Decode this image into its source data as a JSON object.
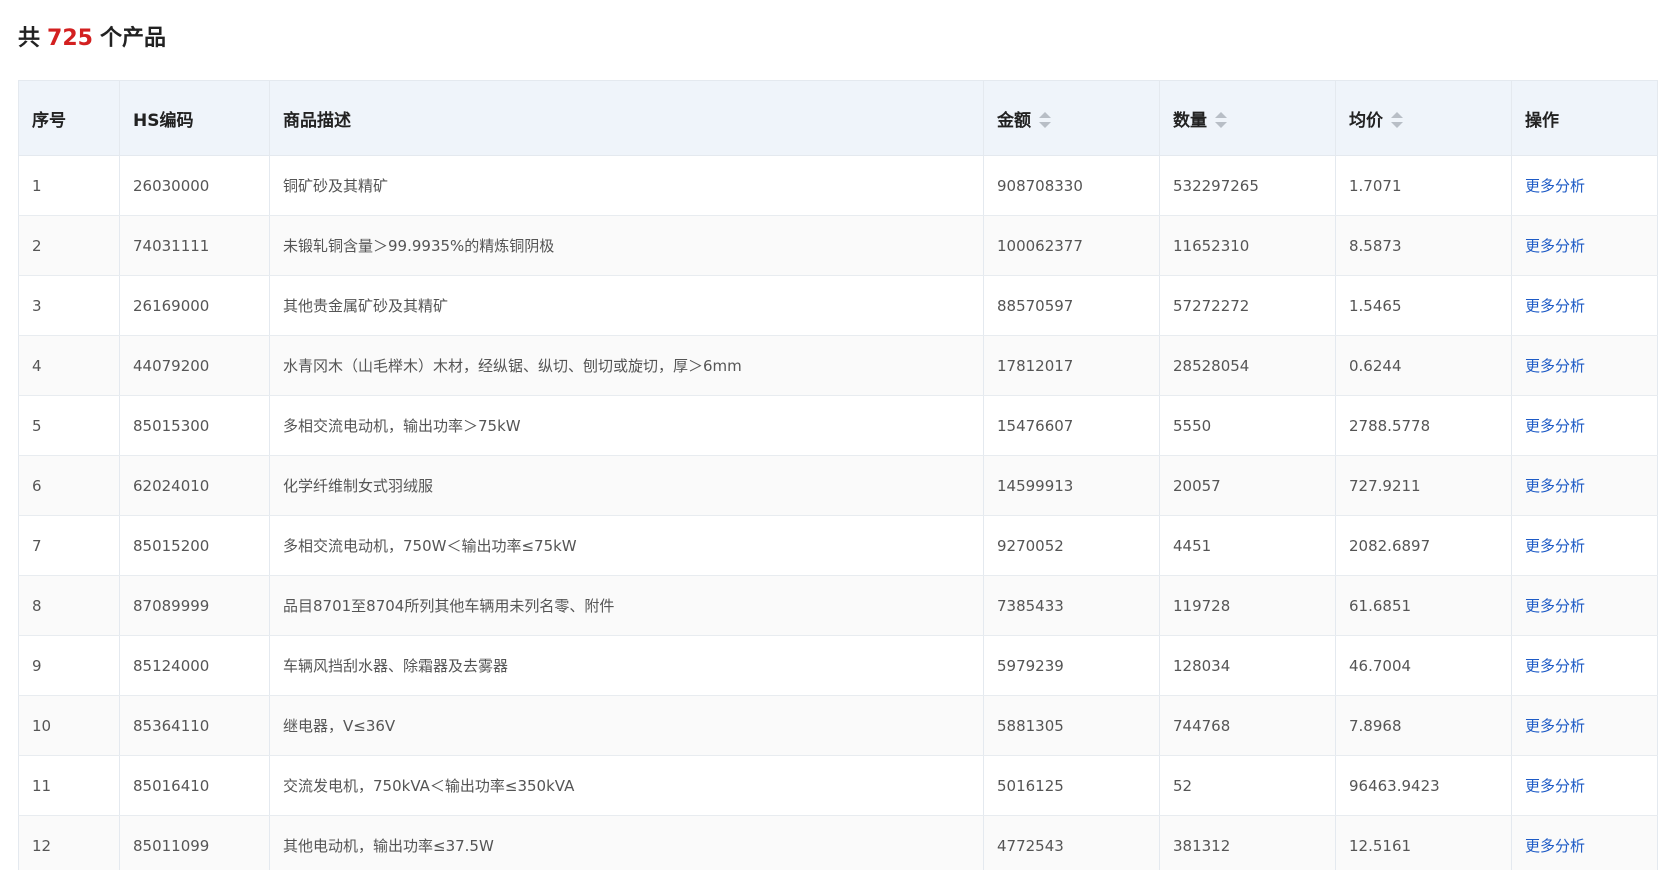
{
  "summary": {
    "prefix": "共",
    "count": "725",
    "suffix": "个产品"
  },
  "table": {
    "headers": {
      "index": "序号",
      "hs_code": "HS编码",
      "description": "商品描述",
      "amount": "金额",
      "quantity": "数量",
      "avg_price": "均价",
      "actions": "操作"
    },
    "sortable_columns": [
      "amount",
      "quantity",
      "avg_price"
    ],
    "action_label": "更多分析",
    "rows": [
      {
        "index": "1",
        "hs_code": "26030000",
        "description": "铜矿砂及其精矿",
        "amount": "908708330",
        "quantity": "532297265",
        "avg_price": "1.7071"
      },
      {
        "index": "2",
        "hs_code": "74031111",
        "description": "未锻轧铜含量＞99.9935%的精炼铜阴极",
        "amount": "100062377",
        "quantity": "11652310",
        "avg_price": "8.5873"
      },
      {
        "index": "3",
        "hs_code": "26169000",
        "description": "其他贵金属矿砂及其精矿",
        "amount": "88570597",
        "quantity": "57272272",
        "avg_price": "1.5465"
      },
      {
        "index": "4",
        "hs_code": "44079200",
        "description": "水青冈木（山毛榉木）木材，经纵锯、纵切、刨切或旋切，厚＞6mm",
        "amount": "17812017",
        "quantity": "28528054",
        "avg_price": "0.6244"
      },
      {
        "index": "5",
        "hs_code": "85015300",
        "description": "多相交流电动机，输出功率＞75kW",
        "amount": "15476607",
        "quantity": "5550",
        "avg_price": "2788.5778"
      },
      {
        "index": "6",
        "hs_code": "62024010",
        "description": "化学纤维制女式羽绒服",
        "amount": "14599913",
        "quantity": "20057",
        "avg_price": "727.9211"
      },
      {
        "index": "7",
        "hs_code": "85015200",
        "description": "多相交流电动机，750W＜输出功率≤75kW",
        "amount": "9270052",
        "quantity": "4451",
        "avg_price": "2082.6897"
      },
      {
        "index": "8",
        "hs_code": "87089999",
        "description": "品目8701至8704所列其他车辆用未列名零、附件",
        "amount": "7385433",
        "quantity": "119728",
        "avg_price": "61.6851"
      },
      {
        "index": "9",
        "hs_code": "85124000",
        "description": "车辆风挡刮水器、除霜器及去雾器",
        "amount": "5979239",
        "quantity": "128034",
        "avg_price": "46.7004"
      },
      {
        "index": "10",
        "hs_code": "85364110",
        "description": "继电器，V≤36V",
        "amount": "5881305",
        "quantity": "744768",
        "avg_price": "7.8968"
      },
      {
        "index": "11",
        "hs_code": "85016410",
        "description": "交流发电机，750kVA＜输出功率≤350kVA",
        "amount": "5016125",
        "quantity": "52",
        "avg_price": "96463.9423"
      },
      {
        "index": "12",
        "hs_code": "85011099",
        "description": "其他电动机，输出功率≤37.5W",
        "amount": "4772543",
        "quantity": "381312",
        "avg_price": "12.5161"
      }
    ]
  }
}
